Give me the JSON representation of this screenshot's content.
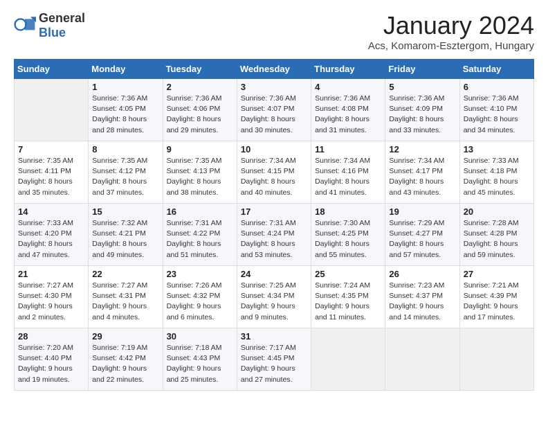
{
  "header": {
    "logo_general": "General",
    "logo_blue": "Blue",
    "month_title": "January 2024",
    "location": "Acs, Komarom-Esztergom, Hungary"
  },
  "weekdays": [
    "Sunday",
    "Monday",
    "Tuesday",
    "Wednesday",
    "Thursday",
    "Friday",
    "Saturday"
  ],
  "weeks": [
    [
      {
        "day": "",
        "sunrise": "",
        "sunset": "",
        "daylight": ""
      },
      {
        "day": "1",
        "sunrise": "Sunrise: 7:36 AM",
        "sunset": "Sunset: 4:05 PM",
        "daylight": "Daylight: 8 hours and 28 minutes."
      },
      {
        "day": "2",
        "sunrise": "Sunrise: 7:36 AM",
        "sunset": "Sunset: 4:06 PM",
        "daylight": "Daylight: 8 hours and 29 minutes."
      },
      {
        "day": "3",
        "sunrise": "Sunrise: 7:36 AM",
        "sunset": "Sunset: 4:07 PM",
        "daylight": "Daylight: 8 hours and 30 minutes."
      },
      {
        "day": "4",
        "sunrise": "Sunrise: 7:36 AM",
        "sunset": "Sunset: 4:08 PM",
        "daylight": "Daylight: 8 hours and 31 minutes."
      },
      {
        "day": "5",
        "sunrise": "Sunrise: 7:36 AM",
        "sunset": "Sunset: 4:09 PM",
        "daylight": "Daylight: 8 hours and 33 minutes."
      },
      {
        "day": "6",
        "sunrise": "Sunrise: 7:36 AM",
        "sunset": "Sunset: 4:10 PM",
        "daylight": "Daylight: 8 hours and 34 minutes."
      }
    ],
    [
      {
        "day": "7",
        "sunrise": "Sunrise: 7:35 AM",
        "sunset": "Sunset: 4:11 PM",
        "daylight": "Daylight: 8 hours and 35 minutes."
      },
      {
        "day": "8",
        "sunrise": "Sunrise: 7:35 AM",
        "sunset": "Sunset: 4:12 PM",
        "daylight": "Daylight: 8 hours and 37 minutes."
      },
      {
        "day": "9",
        "sunrise": "Sunrise: 7:35 AM",
        "sunset": "Sunset: 4:13 PM",
        "daylight": "Daylight: 8 hours and 38 minutes."
      },
      {
        "day": "10",
        "sunrise": "Sunrise: 7:34 AM",
        "sunset": "Sunset: 4:15 PM",
        "daylight": "Daylight: 8 hours and 40 minutes."
      },
      {
        "day": "11",
        "sunrise": "Sunrise: 7:34 AM",
        "sunset": "Sunset: 4:16 PM",
        "daylight": "Daylight: 8 hours and 41 minutes."
      },
      {
        "day": "12",
        "sunrise": "Sunrise: 7:34 AM",
        "sunset": "Sunset: 4:17 PM",
        "daylight": "Daylight: 8 hours and 43 minutes."
      },
      {
        "day": "13",
        "sunrise": "Sunrise: 7:33 AM",
        "sunset": "Sunset: 4:18 PM",
        "daylight": "Daylight: 8 hours and 45 minutes."
      }
    ],
    [
      {
        "day": "14",
        "sunrise": "Sunrise: 7:33 AM",
        "sunset": "Sunset: 4:20 PM",
        "daylight": "Daylight: 8 hours and 47 minutes."
      },
      {
        "day": "15",
        "sunrise": "Sunrise: 7:32 AM",
        "sunset": "Sunset: 4:21 PM",
        "daylight": "Daylight: 8 hours and 49 minutes."
      },
      {
        "day": "16",
        "sunrise": "Sunrise: 7:31 AM",
        "sunset": "Sunset: 4:22 PM",
        "daylight": "Daylight: 8 hours and 51 minutes."
      },
      {
        "day": "17",
        "sunrise": "Sunrise: 7:31 AM",
        "sunset": "Sunset: 4:24 PM",
        "daylight": "Daylight: 8 hours and 53 minutes."
      },
      {
        "day": "18",
        "sunrise": "Sunrise: 7:30 AM",
        "sunset": "Sunset: 4:25 PM",
        "daylight": "Daylight: 8 hours and 55 minutes."
      },
      {
        "day": "19",
        "sunrise": "Sunrise: 7:29 AM",
        "sunset": "Sunset: 4:27 PM",
        "daylight": "Daylight: 8 hours and 57 minutes."
      },
      {
        "day": "20",
        "sunrise": "Sunrise: 7:28 AM",
        "sunset": "Sunset: 4:28 PM",
        "daylight": "Daylight: 8 hours and 59 minutes."
      }
    ],
    [
      {
        "day": "21",
        "sunrise": "Sunrise: 7:27 AM",
        "sunset": "Sunset: 4:30 PM",
        "daylight": "Daylight: 9 hours and 2 minutes."
      },
      {
        "day": "22",
        "sunrise": "Sunrise: 7:27 AM",
        "sunset": "Sunset: 4:31 PM",
        "daylight": "Daylight: 9 hours and 4 minutes."
      },
      {
        "day": "23",
        "sunrise": "Sunrise: 7:26 AM",
        "sunset": "Sunset: 4:32 PM",
        "daylight": "Daylight: 9 hours and 6 minutes."
      },
      {
        "day": "24",
        "sunrise": "Sunrise: 7:25 AM",
        "sunset": "Sunset: 4:34 PM",
        "daylight": "Daylight: 9 hours and 9 minutes."
      },
      {
        "day": "25",
        "sunrise": "Sunrise: 7:24 AM",
        "sunset": "Sunset: 4:35 PM",
        "daylight": "Daylight: 9 hours and 11 minutes."
      },
      {
        "day": "26",
        "sunrise": "Sunrise: 7:23 AM",
        "sunset": "Sunset: 4:37 PM",
        "daylight": "Daylight: 9 hours and 14 minutes."
      },
      {
        "day": "27",
        "sunrise": "Sunrise: 7:21 AM",
        "sunset": "Sunset: 4:39 PM",
        "daylight": "Daylight: 9 hours and 17 minutes."
      }
    ],
    [
      {
        "day": "28",
        "sunrise": "Sunrise: 7:20 AM",
        "sunset": "Sunset: 4:40 PM",
        "daylight": "Daylight: 9 hours and 19 minutes."
      },
      {
        "day": "29",
        "sunrise": "Sunrise: 7:19 AM",
        "sunset": "Sunset: 4:42 PM",
        "daylight": "Daylight: 9 hours and 22 minutes."
      },
      {
        "day": "30",
        "sunrise": "Sunrise: 7:18 AM",
        "sunset": "Sunset: 4:43 PM",
        "daylight": "Daylight: 9 hours and 25 minutes."
      },
      {
        "day": "31",
        "sunrise": "Sunrise: 7:17 AM",
        "sunset": "Sunset: 4:45 PM",
        "daylight": "Daylight: 9 hours and 27 minutes."
      },
      {
        "day": "",
        "sunrise": "",
        "sunset": "",
        "daylight": ""
      },
      {
        "day": "",
        "sunrise": "",
        "sunset": "",
        "daylight": ""
      },
      {
        "day": "",
        "sunrise": "",
        "sunset": "",
        "daylight": ""
      }
    ]
  ]
}
